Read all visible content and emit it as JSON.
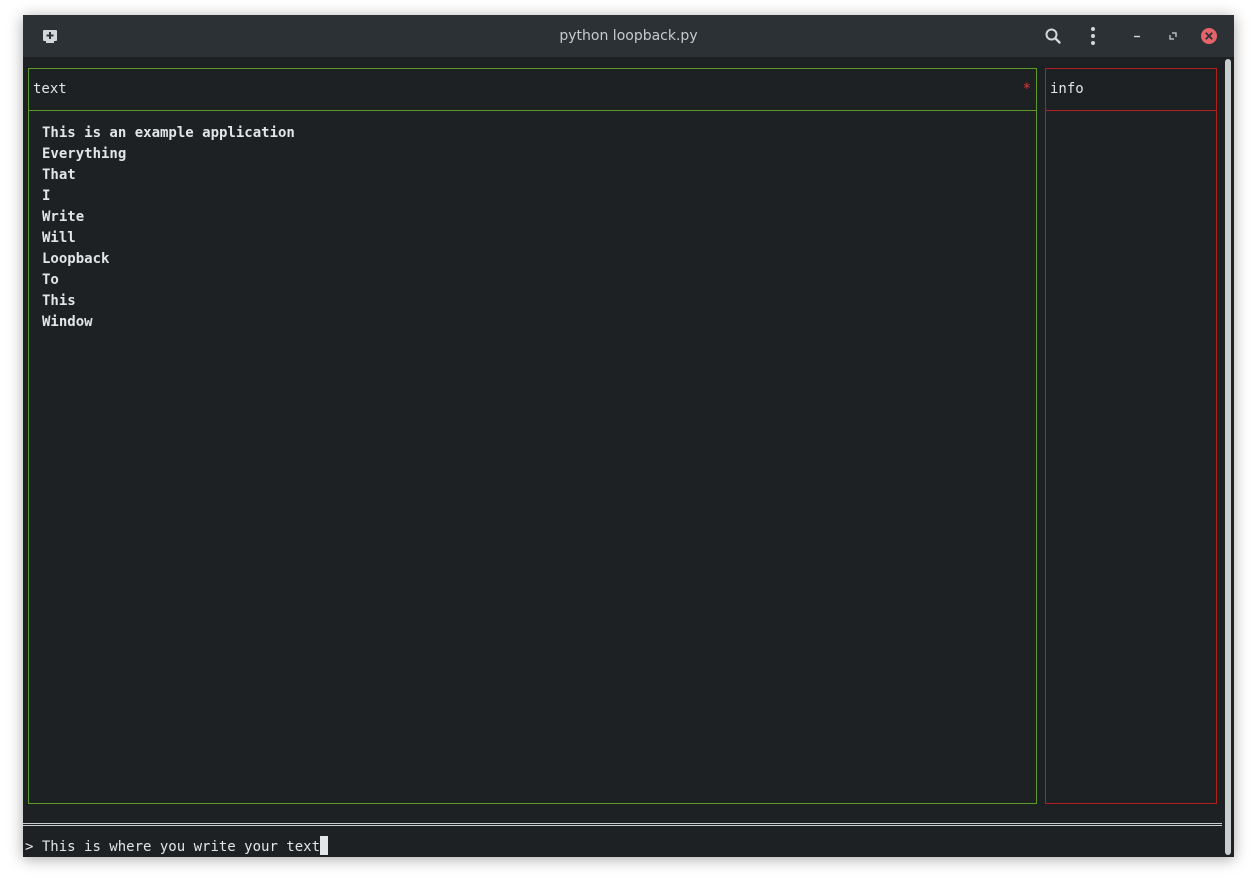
{
  "window": {
    "title": "python loopback.py",
    "icons": {
      "new_tab": "new-tab-icon",
      "search": "search-icon",
      "menu": "kebab-menu-icon",
      "minimize": "minimize-icon",
      "restore": "restore-icon",
      "close": "close-icon"
    },
    "colors": {
      "background": "#1d2123",
      "titlebar": "#2b3134",
      "text_border": "#5e9a25",
      "info_border": "#b1201f",
      "close_button": "#e5636a",
      "marker": "#e03a3a"
    }
  },
  "text_panel": {
    "label": "text",
    "marker": "*",
    "lines": [
      "This is an example application",
      "Everything",
      "That",
      "I",
      "Write",
      "Will",
      "Loopback",
      "To",
      "This",
      "Window"
    ]
  },
  "info_panel": {
    "label": "info"
  },
  "input": {
    "prompt": ">",
    "value": "This is where you write your text"
  }
}
